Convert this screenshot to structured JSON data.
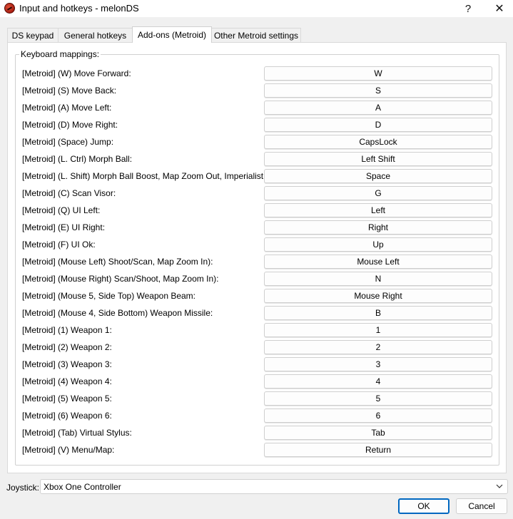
{
  "window": {
    "title": "Input and hotkeys - melonDS",
    "help_glyph": "?",
    "close_glyph": "✕"
  },
  "tabs": [
    {
      "label": "DS keypad",
      "active": false
    },
    {
      "label": "General hotkeys",
      "active": false
    },
    {
      "label": "Add-ons (Metroid)",
      "active": true
    },
    {
      "label": "Other Metroid settings",
      "active": false
    }
  ],
  "group": {
    "title": "Keyboard mappings:"
  },
  "mappings": [
    {
      "label": "[Metroid] (W) Move Forward:",
      "key": "W"
    },
    {
      "label": "[Metroid] (S) Move Back:",
      "key": "S"
    },
    {
      "label": "[Metroid] (A) Move Left:",
      "key": "A"
    },
    {
      "label": "[Metroid] (D) Move Right:",
      "key": "D"
    },
    {
      "label": "[Metroid] (Space) Jump:",
      "key": "CapsLock"
    },
    {
      "label": "[Metroid] (L. Ctrl) Morph Ball:",
      "key": "Left Shift"
    },
    {
      "label": "[Metroid] (L. Shift) Morph Ball Boost, Map Zoom Out, Imperialist Zoom:",
      "key": "Space"
    },
    {
      "label": "[Metroid] (C) Scan Visor:",
      "key": "G"
    },
    {
      "label": "[Metroid] (Q) UI Left:",
      "key": "Left"
    },
    {
      "label": "[Metroid] (E) UI Right:",
      "key": "Right"
    },
    {
      "label": "[Metroid] (F) UI Ok:",
      "key": "Up"
    },
    {
      "label": "[Metroid] (Mouse Left) Shoot/Scan, Map Zoom In):",
      "key": "Mouse Left"
    },
    {
      "label": "[Metroid] (Mouse Right) Scan/Shoot, Map Zoom In):",
      "key": "N"
    },
    {
      "label": "[Metroid] (Mouse 5, Side Top) Weapon Beam:",
      "key": "Mouse Right"
    },
    {
      "label": "[Metroid] (Mouse 4, Side Bottom) Weapon Missile:",
      "key": "B"
    },
    {
      "label": "[Metroid] (1) Weapon 1:",
      "key": "1"
    },
    {
      "label": "[Metroid] (2) Weapon 2:",
      "key": "2"
    },
    {
      "label": "[Metroid] (3) Weapon 3:",
      "key": "3"
    },
    {
      "label": "[Metroid] (4) Weapon 4:",
      "key": "4"
    },
    {
      "label": "[Metroid] (5) Weapon 5:",
      "key": "5"
    },
    {
      "label": "[Metroid] (6) Weapon 6:",
      "key": "6"
    },
    {
      "label": "[Metroid] (Tab) Virtual Stylus:",
      "key": "Tab"
    },
    {
      "label": "[Metroid] (V) Menu/Map:",
      "key": "Return"
    }
  ],
  "joystick": {
    "label": "Joystick:",
    "selected": "Xbox One Controller"
  },
  "footer": {
    "ok_label": "OK",
    "cancel_label": "Cancel"
  },
  "colors": {
    "accent": "#0067c0"
  }
}
